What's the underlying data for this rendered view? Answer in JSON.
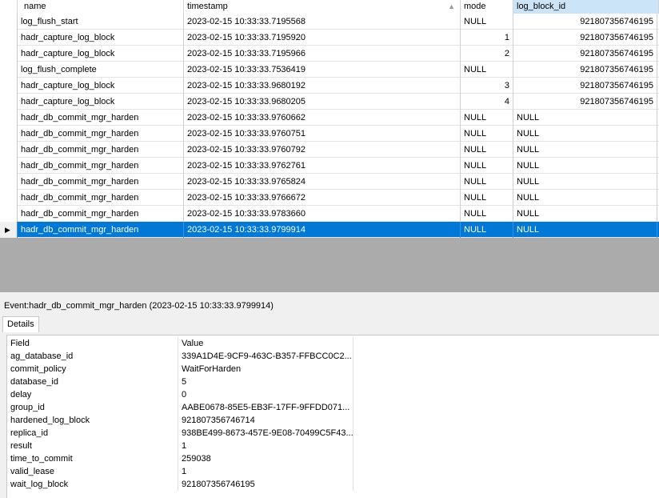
{
  "grid": {
    "headers": {
      "name": "name",
      "timestamp": "timestamp",
      "mode": "mode",
      "log_block_id": "log_block_id"
    },
    "rows": [
      {
        "name": "log_flush_start",
        "timestamp": "2023-02-15 10:33:33.7195568",
        "mode": "NULL",
        "log_block_id": "921807356746195"
      },
      {
        "name": "hadr_capture_log_block",
        "timestamp": "2023-02-15 10:33:33.7195920",
        "mode": "1",
        "log_block_id": "921807356746195"
      },
      {
        "name": "hadr_capture_log_block",
        "timestamp": "2023-02-15 10:33:33.7195966",
        "mode": "2",
        "log_block_id": "921807356746195"
      },
      {
        "name": "log_flush_complete",
        "timestamp": "2023-02-15 10:33:33.7536419",
        "mode": "NULL",
        "log_block_id": "921807356746195"
      },
      {
        "name": "hadr_capture_log_block",
        "timestamp": "2023-02-15 10:33:33.9680192",
        "mode": "3",
        "log_block_id": "921807356746195"
      },
      {
        "name": "hadr_capture_log_block",
        "timestamp": "2023-02-15 10:33:33.9680205",
        "mode": "4",
        "log_block_id": "921807356746195"
      },
      {
        "name": "hadr_db_commit_mgr_harden",
        "timestamp": "2023-02-15 10:33:33.9760662",
        "mode": "NULL",
        "log_block_id": "NULL"
      },
      {
        "name": "hadr_db_commit_mgr_harden",
        "timestamp": "2023-02-15 10:33:33.9760751",
        "mode": "NULL",
        "log_block_id": "NULL"
      },
      {
        "name": "hadr_db_commit_mgr_harden",
        "timestamp": "2023-02-15 10:33:33.9760792",
        "mode": "NULL",
        "log_block_id": "NULL"
      },
      {
        "name": "hadr_db_commit_mgr_harden",
        "timestamp": "2023-02-15 10:33:33.9762761",
        "mode": "NULL",
        "log_block_id": "NULL"
      },
      {
        "name": "hadr_db_commit_mgr_harden",
        "timestamp": "2023-02-15 10:33:33.9765824",
        "mode": "NULL",
        "log_block_id": "NULL"
      },
      {
        "name": "hadr_db_commit_mgr_harden",
        "timestamp": "2023-02-15 10:33:33.9766672",
        "mode": "NULL",
        "log_block_id": "NULL"
      },
      {
        "name": "hadr_db_commit_mgr_harden",
        "timestamp": "2023-02-15 10:33:33.9783660",
        "mode": "NULL",
        "log_block_id": "NULL"
      },
      {
        "name": "hadr_db_commit_mgr_harden",
        "timestamp": "2023-02-15 10:33:33.9799914",
        "mode": "NULL",
        "log_block_id": "NULL"
      }
    ],
    "selected_row_marker": "▶"
  },
  "event": {
    "label": "Event:hadr_db_commit_mgr_harden (2023-02-15 10:33:33.9799914)",
    "tab": "Details"
  },
  "details": {
    "headers": {
      "field": "Field",
      "value": "Value"
    },
    "rows": [
      {
        "field": "ag_database_id",
        "value": "339A1D4E-9CF9-463C-B357-FFBCC0C2..."
      },
      {
        "field": "commit_policy",
        "value": "WaitForHarden"
      },
      {
        "field": "database_id",
        "value": "5"
      },
      {
        "field": "delay",
        "value": "0"
      },
      {
        "field": "group_id",
        "value": "AABE0678-85E5-EB3F-17FF-9FFDD071..."
      },
      {
        "field": "hardened_log_block",
        "value": "921807356746714"
      },
      {
        "field": "replica_id",
        "value": "938BE499-8673-457E-9E08-70499C5F43..."
      },
      {
        "field": "result",
        "value": "1"
      },
      {
        "field": "time_to_commit",
        "value": "259038"
      },
      {
        "field": "valid_lease",
        "value": "1"
      },
      {
        "field": "wait_log_block",
        "value": "921807356746195"
      }
    ]
  }
}
